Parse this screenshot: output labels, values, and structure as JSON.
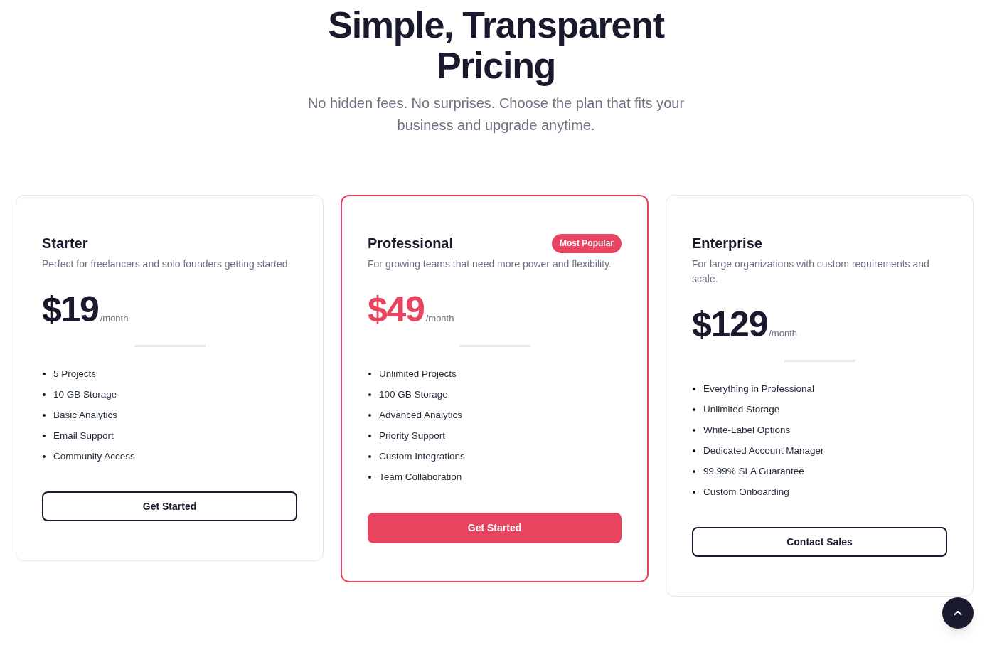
{
  "header": {
    "title": "Simple, Transparent Pricing",
    "subtitle": "No hidden fees. No surprises. Choose the plan that fits your business and upgrade anytime."
  },
  "plans": [
    {
      "name": "Starter",
      "featured": false,
      "description": "Perfect for freelancers and solo founders getting started.",
      "price": "$19",
      "period": "/month",
      "features": [
        "5 Projects",
        "10 GB Storage",
        "Basic Analytics",
        "Email Support",
        "Community Access"
      ],
      "button": "Get Started"
    },
    {
      "name": "Professional",
      "featured": true,
      "badge": "Most Popular",
      "description": "For growing teams that need more power and flexibility.",
      "price": "$49",
      "period": "/month",
      "features": [
        "Unlimited Projects",
        "100 GB Storage",
        "Advanced Analytics",
        "Priority Support",
        "Custom Integrations",
        "Team Collaboration"
      ],
      "button": "Get Started"
    },
    {
      "name": "Enterprise",
      "featured": false,
      "description": "For large organizations with custom requirements and scale.",
      "price": "$129",
      "period": "/month",
      "features": [
        "Everything in Professional",
        "Unlimited Storage",
        "White-Label Options",
        "Dedicated Account Manager",
        "99.99% SLA Guarantee",
        "Custom Onboarding"
      ],
      "button": "Contact Sales"
    }
  ]
}
